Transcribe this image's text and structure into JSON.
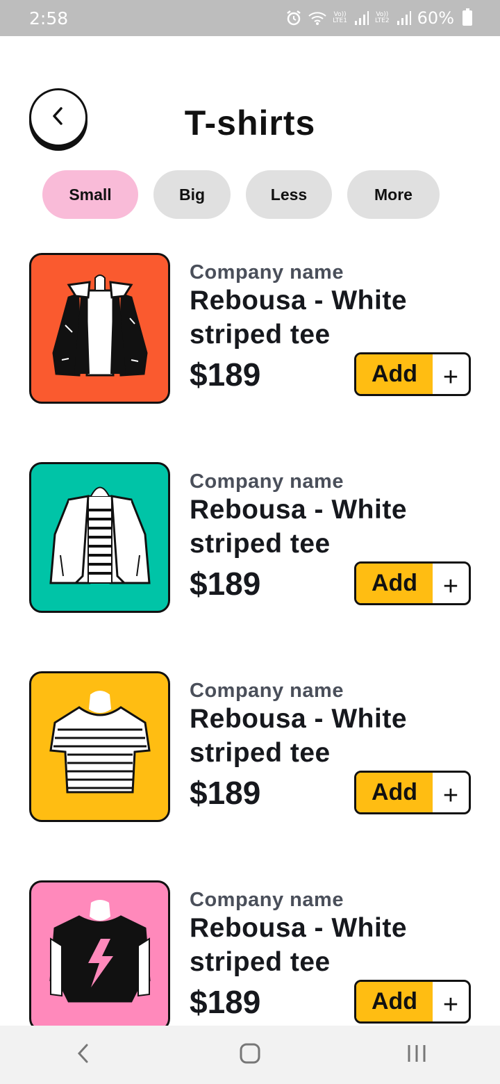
{
  "status_bar": {
    "time": "2:58",
    "sim1_label": [
      "Vo))",
      "LTE1"
    ],
    "sim2_label": [
      "Vo))",
      "LTE2"
    ],
    "battery": "60%",
    "icons": [
      "alarm-icon",
      "wifi-icon",
      "signal-icon",
      "signal-icon",
      "battery-icon"
    ]
  },
  "header": {
    "title": "T-shirts",
    "back_icon": "chevron-left-icon"
  },
  "filters": [
    {
      "label": "Small",
      "active": true
    },
    {
      "label": "Big",
      "active": false
    },
    {
      "label": "Less",
      "active": false
    },
    {
      "label": "More",
      "active": false
    }
  ],
  "products": [
    {
      "company": "Company name",
      "name": "Rebousa - White striped tee",
      "price": "$189",
      "add_label": "Add",
      "plus": "+",
      "image": "leather-jacket-illustration",
      "bg": "#fa5a2f"
    },
    {
      "company": "Company name",
      "name": "Rebousa - White striped tee",
      "price": "$189",
      "add_label": "Add",
      "plus": "+",
      "image": "white-blazer-illustration",
      "bg": "#00c4a7"
    },
    {
      "company": "Company name",
      "name": "Rebousa - White striped tee",
      "price": "$189",
      "add_label": "Add",
      "plus": "+",
      "image": "striped-tee-illustration",
      "bg": "#ffbd12"
    },
    {
      "company": "Company name",
      "name": "Rebousa - White striped tee",
      "price": "$189",
      "add_label": "Add",
      "plus": "+",
      "image": "lightning-tee-illustration",
      "bg": "#ff89bb"
    }
  ],
  "nav_bar": {
    "icons": [
      "back-nav-icon",
      "home-nav-icon",
      "recents-nav-icon"
    ]
  },
  "colors": {
    "accent": "#ffbd12",
    "chip_active": "#f9bbd8",
    "chip_inactive": "#e0e0e0",
    "text_dark": "#16181d",
    "text_muted": "#4a4f5a"
  }
}
